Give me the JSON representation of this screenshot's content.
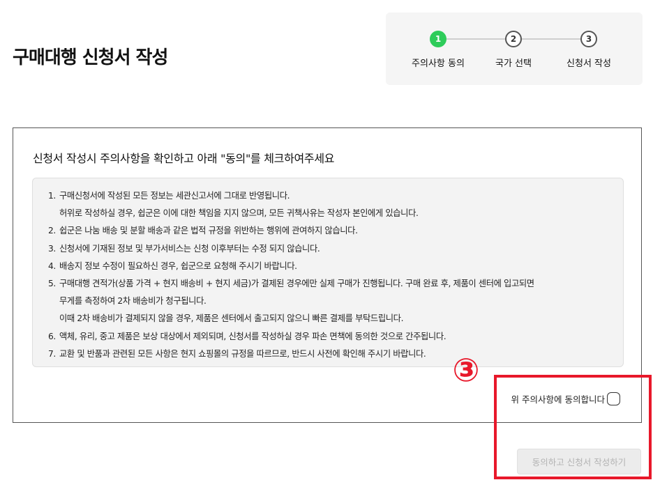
{
  "page": {
    "title": "구매대행 신청서 작성"
  },
  "stepper": {
    "steps": [
      {
        "number": "1",
        "label": "주의사항 동의",
        "state": "active"
      },
      {
        "number": "2",
        "label": "국가 선택",
        "state": "inactive"
      },
      {
        "number": "3",
        "label": "신청서 작성",
        "state": "inactive"
      }
    ]
  },
  "notice": {
    "heading": "신청서 작성시 주의사항을 확인하고 아래 \"동의\"를 체크하여주세요",
    "rules": [
      {
        "num": "1.",
        "lines": [
          "구매신청서에 작성된 모든 정보는 세관신고서에 그대로 반영됩니다.",
          "허위로 작성하실 경우, 쉽군은 이에 대한 책임을 지지 않으며, 모든 귀책사유는 작성자 본인에게 있습니다."
        ]
      },
      {
        "num": "2.",
        "lines": [
          "쉽군은 나눔 배송 및 분할 배송과 같은 법적 규정을 위반하는 행위에 관여하지 않습니다."
        ]
      },
      {
        "num": "3.",
        "lines": [
          "신청서에 기재된 정보 및 부가서비스는 신청 이후부터는 수정 되지 않습니다."
        ]
      },
      {
        "num": "4.",
        "lines": [
          "배송지 정보 수정이 필요하신 경우, 쉽군으로 요청해 주시기 바랍니다."
        ]
      },
      {
        "num": "5.",
        "lines": [
          "구매대행 견적가(상품 가격 + 현지 배송비 + 현지 세금)가 결제된 경우에만 실제 구매가 진행됩니다. 구매 완료 후, 제품이 센터에 입고되면",
          "무게를 측정하여 2차 배송비가 청구됩니다.",
          "이때 2차 배송비가 결제되지 않을 경우, 제품은 센터에서 출고되지 않으니 빠른 결제를 부탁드립니다."
        ]
      },
      {
        "num": "6.",
        "lines": [
          "액체, 유리, 중고 제품은 보상 대상에서 제외되며, 신청서를 작성하실 경우 파손 면책에 동의한 것으로 간주됩니다."
        ]
      },
      {
        "num": "7.",
        "lines": [
          "교환 및 반품과 관련된 모든 사항은 현지 쇼핑몰의 규정을 따르므로, 반드시 사전에 확인해 주시기 바랍니다."
        ]
      }
    ]
  },
  "agreement": {
    "label": "위 주의사항에 동의합니다",
    "checked": false
  },
  "submit": {
    "label": "동의하고 신청서 작성하기",
    "enabled": false
  },
  "annotation": {
    "marker": "③",
    "color": "#e8182a"
  },
  "colors": {
    "accent": "#2ecc5a",
    "annotation": "#e8182a"
  }
}
